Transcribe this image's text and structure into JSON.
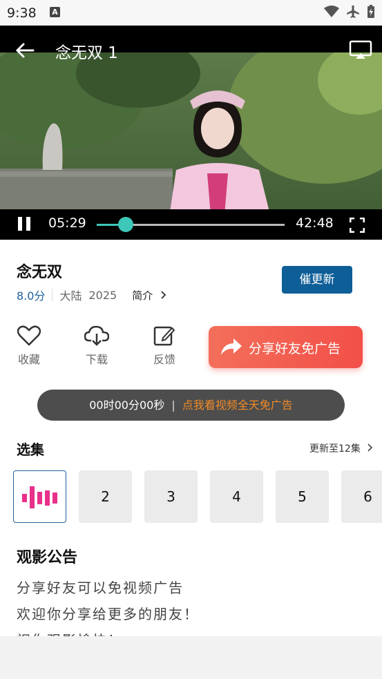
{
  "status": {
    "time": "9:38",
    "app_badge": "A"
  },
  "player": {
    "title": "念无双 1",
    "current_time": "05:29",
    "duration": "42:48",
    "progress_fraction": 0.155
  },
  "show": {
    "title": "念无双",
    "rating": "8.0分",
    "region": "大陆",
    "year": "2025",
    "intro_label": "简介",
    "urge_label": "催更新"
  },
  "actions": {
    "favorite": "收藏",
    "download": "下载",
    "feedback": "反馈",
    "share": "分享好友免广告"
  },
  "timer": {
    "value": "00时00分00秒",
    "divider": "|",
    "link": "点我看视频全天免广告"
  },
  "episodes": {
    "section_title": "选集",
    "updated_label": "更新至12集",
    "items": [
      "1",
      "2",
      "3",
      "4",
      "5",
      "6"
    ]
  },
  "notice": {
    "title": "观影公告",
    "lines": [
      "分享好友可以免视频广告",
      "欢迎你分享给更多的朋友！",
      "祝你观影愉快！"
    ]
  },
  "colors": {
    "accent": "#0e5e98",
    "progress": "#3ec7b8",
    "share": "#f24f48",
    "link": "#f08b27",
    "playing_bars": "#e8308a"
  }
}
